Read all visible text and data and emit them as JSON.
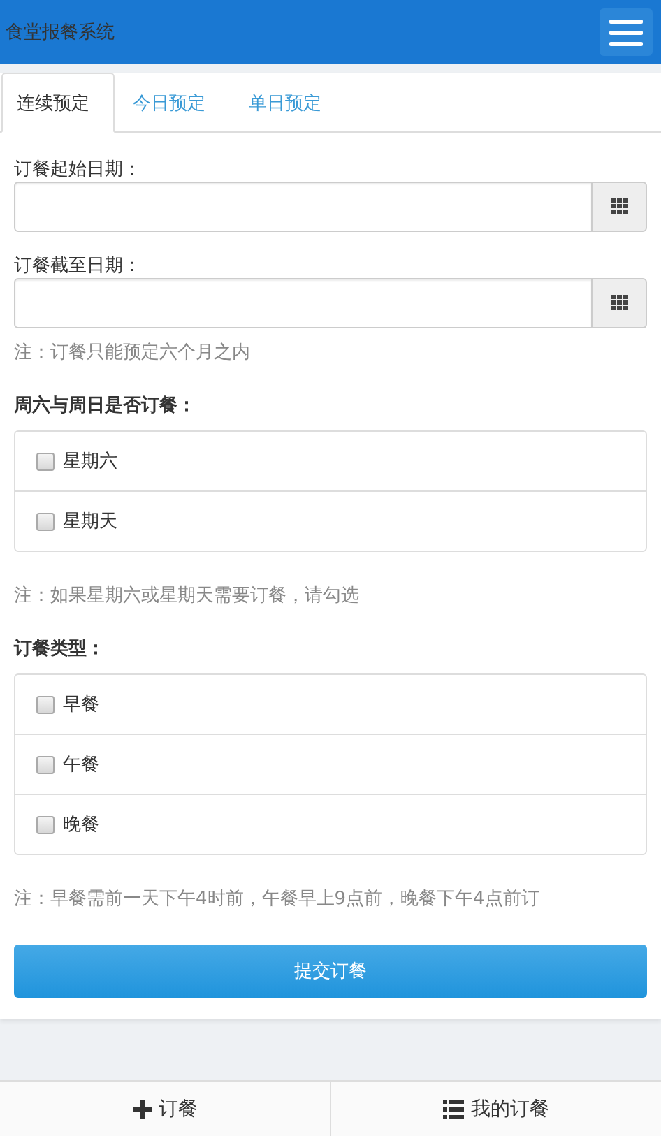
{
  "header": {
    "title": "食堂报餐系统"
  },
  "tabs": [
    {
      "label": "连续预定",
      "selected": true
    },
    {
      "label": "今日预定",
      "selected": false
    },
    {
      "label": "单日预定",
      "selected": false
    }
  ],
  "form": {
    "start_date": {
      "label": "订餐起始日期："
    },
    "end_date": {
      "label": "订餐截至日期："
    },
    "date_note": "注：订餐只能预定六个月之内",
    "weekend": {
      "label": "周六与周日是否订餐：",
      "options": [
        {
          "label": "星期六",
          "checked": false
        },
        {
          "label": "星期天",
          "checked": false
        }
      ],
      "note": "注：如果星期六或星期天需要订餐，请勾选"
    },
    "meal_type": {
      "label": "订餐类型：",
      "options": [
        {
          "label": "早餐",
          "checked": false
        },
        {
          "label": "午餐",
          "checked": false
        },
        {
          "label": "晚餐",
          "checked": false
        }
      ],
      "note": "注：早餐需前一天下午4时前，午餐早上9点前，晚餐下午4点前订"
    },
    "submit": "提交订餐"
  },
  "bottom_nav": [
    {
      "label": "订餐",
      "kind": "plus"
    },
    {
      "label": "我的订餐",
      "kind": "list"
    }
  ]
}
